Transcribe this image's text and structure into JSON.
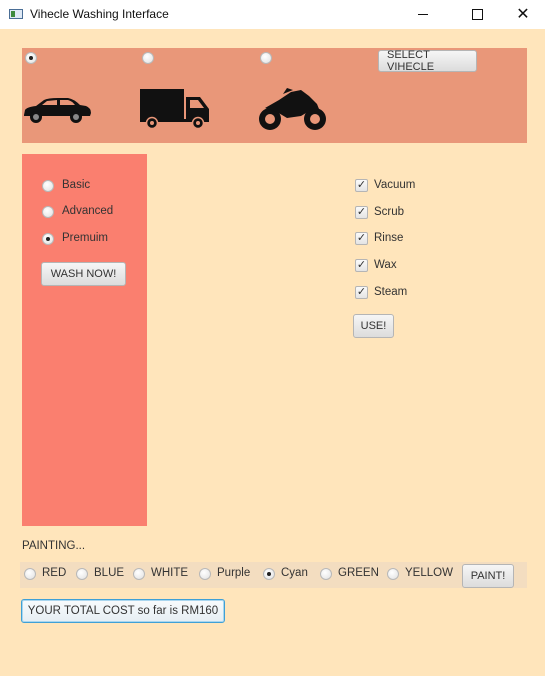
{
  "window": {
    "title": "Vihecle Washing Interface",
    "minimize_glyph": "",
    "maximize_glyph": "",
    "close_glyph": "✕"
  },
  "vehicle": {
    "options": [
      {
        "name": "car",
        "icon": "car-icon",
        "selected": true
      },
      {
        "name": "truck",
        "icon": "truck-icon",
        "selected": false
      },
      {
        "name": "motorcycle",
        "icon": "motorcycle-icon",
        "selected": false
      }
    ],
    "select_button": "SELECT VIHECLE"
  },
  "package": {
    "options": [
      {
        "label": "Basic",
        "selected": false
      },
      {
        "label": "Advanced",
        "selected": false
      },
      {
        "label": "Premuim",
        "selected": true
      }
    ],
    "wash_button": "WASH NOW!"
  },
  "services": {
    "items": [
      {
        "label": "Vacuum",
        "checked": true
      },
      {
        "label": "Scrub",
        "checked": true
      },
      {
        "label": "Rinse",
        "checked": true
      },
      {
        "label": "Wax",
        "checked": true
      },
      {
        "label": "Steam",
        "checked": true
      }
    ],
    "use_button": "USE!",
    "check_glyph": "✓"
  },
  "painting": {
    "heading": "PAINTING...",
    "colors": [
      {
        "label": "RED",
        "selected": false
      },
      {
        "label": "BLUE",
        "selected": false
      },
      {
        "label": "WHITE",
        "selected": false
      },
      {
        "label": "Purple",
        "selected": false
      },
      {
        "label": "Cyan",
        "selected": true
      },
      {
        "label": "GREEN",
        "selected": false
      },
      {
        "label": "YELLOW",
        "selected": false
      }
    ],
    "paint_button": "PAINT!"
  },
  "total": {
    "label": "YOUR TOTAL COST so far is RM160"
  },
  "colors": {
    "background": "#ffe5bb",
    "vehicle_bar": "#e99779",
    "package_panel": "#fa7f6f",
    "focus_border": "#3fa0d6"
  }
}
